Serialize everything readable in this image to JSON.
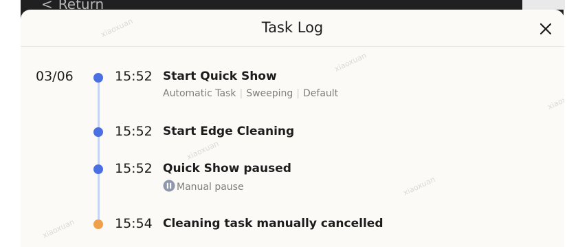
{
  "background": {
    "return_label": "Return"
  },
  "dialog": {
    "title": "Task Log",
    "date": "03/06",
    "watermark": "xiaoxuan"
  },
  "events": [
    {
      "time": "15:52",
      "title": "Start Quick Show",
      "dot_color": "#4a6fe3",
      "tags": [
        "Automatic Task",
        "Sweeping",
        "Default"
      ]
    },
    {
      "time": "15:52",
      "title": "Start Edge Cleaning",
      "dot_color": "#4a6fe3"
    },
    {
      "time": "15:52",
      "title": "Quick Show paused",
      "dot_color": "#4a6fe3",
      "note": "Manual pause",
      "note_icon": "pause-circle-icon"
    },
    {
      "time": "15:54",
      "title": "Cleaning task manually cancelled",
      "dot_color": "#f0a04b"
    }
  ],
  "colors": {
    "accent": "#4a6fe3",
    "warning": "#f0a04b",
    "timeline": "#c9d4f3"
  }
}
